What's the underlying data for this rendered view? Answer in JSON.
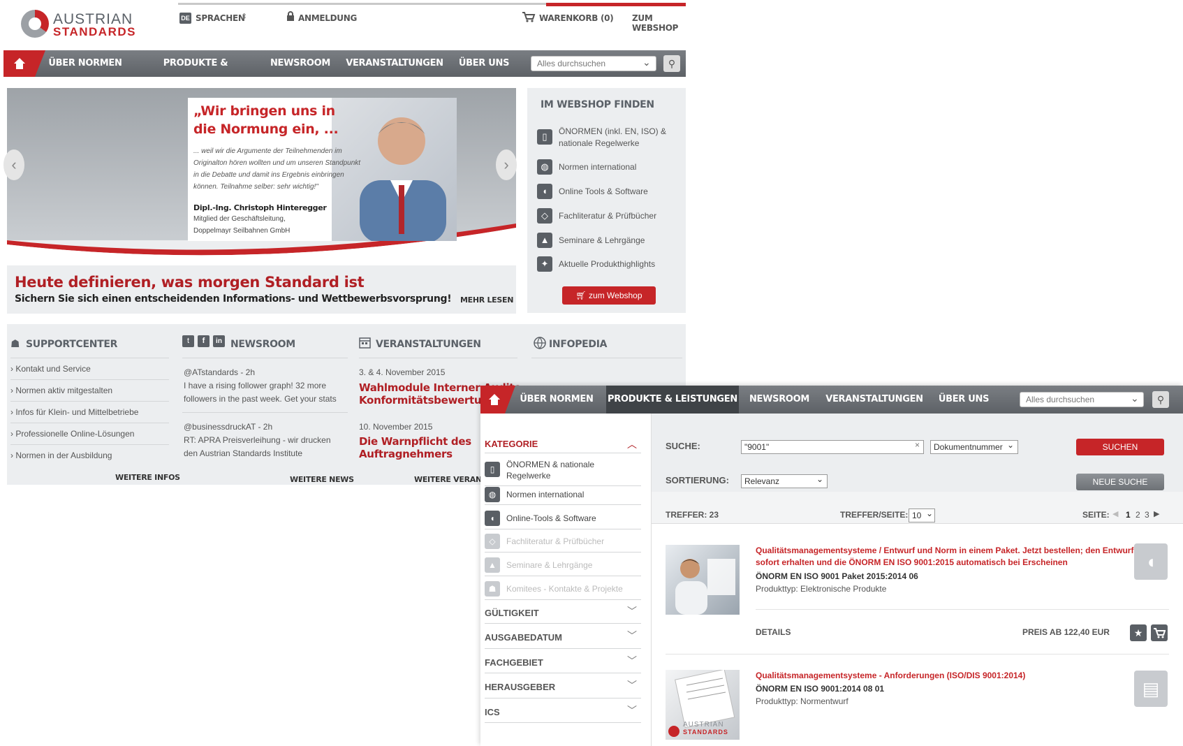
{
  "home": {
    "logo": {
      "line1": "AUSTRIAN",
      "line2": "STANDARDS"
    },
    "top": {
      "lang": "DE",
      "sprachen": "SPRACHEN",
      "anmeldung": "ANMELDUNG",
      "warenkorb": "WARENKORB (0)",
      "webshop": "ZUM WEBSHOP"
    },
    "nav": [
      "ÜBER NORMEN",
      "PRODUKTE & LEISTUNGEN",
      "NEWSROOM",
      "VERANSTALTUNGEN",
      "ÜBER UNS"
    ],
    "search_placeholder": "Alles durchsuchen",
    "hero": {
      "quote1": "„Wir bringen uns in",
      "quote2": "die Normung ein, ...",
      "text1": "... weil wir die Argumente der Teilnehmenden im",
      "text2": "Originalton hören wollten und um unseren Standpunkt",
      "text3": "in die Debatte und damit ins Ergebnis einbringen",
      "text4": "können. Teilnahme selber: sehr wichtig!\"",
      "name": "Dipl.-Ing. Christoph Hinteregger",
      "role1": "Mitglied der Geschäftsleitung,",
      "role2": "Doppelmayr Seilbahnen GmbH",
      "headline": "Heute definieren, was morgen Standard ist",
      "subline": "Sichern Sie sich einen entscheidenden Informations- und Wettbewerbsvorsprung!",
      "more": "MEHR LESEN"
    },
    "webshop_panel": {
      "title": "IM WEBSHOP FINDEN",
      "items": [
        "ÖNORMEN (inkl. EN, ISO) &",
        "nationale Regelwerke",
        "Normen international",
        "Online Tools & Software",
        "Fachliteratur & Prüfbücher",
        "Seminare & Lehrgänge",
        "Aktuelle Produkthighlights"
      ],
      "button": "zum Webshop"
    },
    "support": {
      "title": "SUPPORTCENTER",
      "links": [
        "Kontakt und Service",
        "Normen aktiv mitgestalten",
        "Infos für Klein- und Mittelbetriebe",
        "Professionelle Online-Lösungen",
        "Normen in der Ausbildung"
      ],
      "more": "WEITERE INFOS"
    },
    "newsroom": {
      "title": "NEWSROOM",
      "t1": "@ATstandards - 2h",
      "t1a": "I have a rising follower graph! 32 more",
      "t1b": "followers in the past week. Get your stats",
      "t2": "@businessdruckAT - 2h",
      "t2a": "RT: APRA Preisverleihung - wir drucken",
      "t2b": "den Austrian Standards Institute",
      "more": "WEITERE NEWS"
    },
    "events": {
      "title": "VERANSTALTUNGEN",
      "d1": "3. & 4. November 2015",
      "e1a": "Wahlmodule Interner Audito...",
      "e1b": "Konformitätsbewertungsste...",
      "d2": "10. November 2015",
      "e2a": "Die Warnpflicht des",
      "e2b": "Auftragnehmers",
      "more": "WEITERE VERANSTA..."
    },
    "infopedia": {
      "title": "INFOPEDIA"
    }
  },
  "search": {
    "nav": [
      "ÜBER NORMEN",
      "PRODUKTE & LEISTUNGEN",
      "NEWSROOM",
      "VERANSTALTUNGEN",
      "ÜBER UNS"
    ],
    "search_placeholder": "Alles durchsuchen",
    "kategorie": "KATEGORIE",
    "categories": [
      "ÖNORMEN & nationale",
      "Regelwerke",
      "Normen international",
      "Online-Tools & Software",
      "Fachliteratur & Prüfbücher",
      "Seminare & Lehrgänge",
      "Komitees - Kontakte & Projekte"
    ],
    "facets": [
      "GÜLTIGKEIT",
      "AUSGABEDATUM",
      "FACHGEBIET",
      "HERAUSGEBER",
      "ICS"
    ],
    "suche_label": "SUCHE:",
    "query": "\"9001\"",
    "field": "Dokumentnummer",
    "suchen": "SUCHEN",
    "sort_label": "SORTIERUNG:",
    "sort": "Relevanz",
    "neue_suche": "NEUE SUCHE",
    "treffer": "TREFFER:  23",
    "per_page_label": "TREFFER/SEITE:",
    "per_page": "10",
    "seite": "SEITE:",
    "pages": [
      "1",
      "2",
      "3"
    ],
    "results": [
      {
        "title1": "Qualitätsmanagementsysteme / Entwurf und Norm in einem Paket. Jetzt bestellen; den Entwurf",
        "title2": "sofort erhalten und die ÖNORM EN ISO 9001:2015 automatisch bei Erscheinen",
        "sub": "ÖNORM EN ISO 9001 Paket 2015:2014 06",
        "meta": "Produkttyp: Elektronische Produkte",
        "details": "DETAILS",
        "price": "PREIS AB 122,40 EUR"
      },
      {
        "title1": "Qualitätsmanagementsysteme - Anforderungen (ISO/DIS 9001:2014)",
        "sub": "ÖNORM EN ISO 9001:2014 08 01",
        "meta": "Produkttyp: Normentwurf",
        "thumb_logo1": "AUSTRIAN",
        "thumb_logo2": "STANDARDS"
      }
    ],
    "colors": {
      "brand_red": "#c62528",
      "nav_gray": "#6b6f74"
    }
  }
}
